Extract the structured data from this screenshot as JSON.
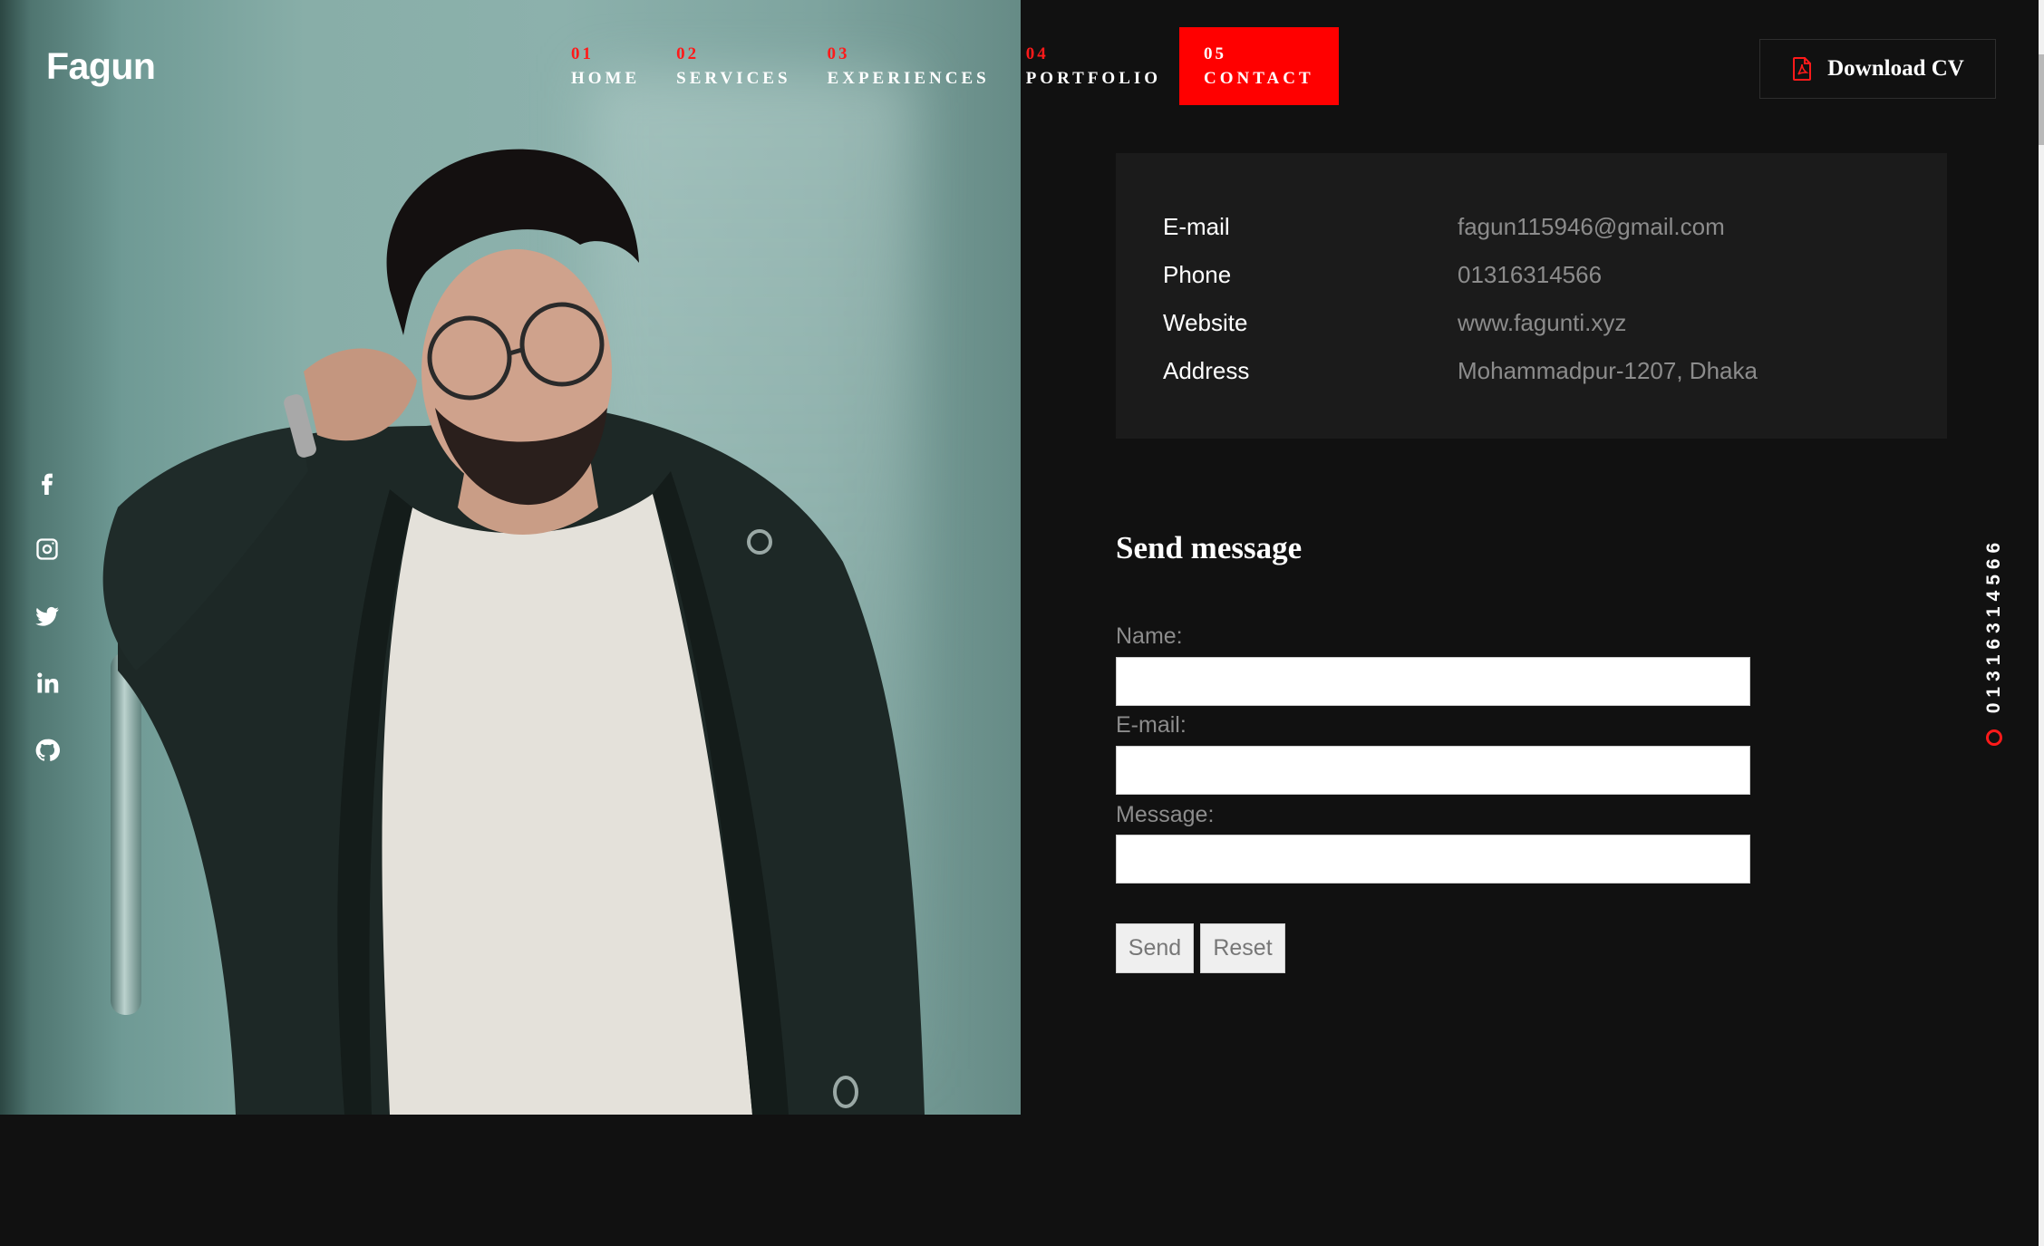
{
  "brand": {
    "name": "Fagun"
  },
  "nav": {
    "items": [
      {
        "num": "01",
        "label": "HOME"
      },
      {
        "num": "02",
        "label": "SERVICES"
      },
      {
        "num": "03",
        "label": "EXPERIENCES"
      },
      {
        "num": "04",
        "label": "PORTFOLIO"
      },
      {
        "num": "05",
        "label": "CONTACT"
      }
    ],
    "active_index": 4,
    "accent_color": "#ff0000"
  },
  "cv_button": {
    "label": "Download CV",
    "icon": "pdf-file-icon"
  },
  "social": {
    "icons": [
      "facebook-icon",
      "instagram-icon",
      "twitter-icon",
      "linkedin-icon",
      "github-icon"
    ]
  },
  "contact_info": {
    "rows": [
      {
        "key": "E-mail",
        "value": "fagun115946@gmail.com"
      },
      {
        "key": "Phone",
        "value": "01316314566"
      },
      {
        "key": "Website",
        "value": "www.fagunti.xyz"
      },
      {
        "key": "Address",
        "value": "Mohammadpur-1207, Dhaka"
      }
    ]
  },
  "form": {
    "title": "Send message",
    "name_label": "Name:",
    "name_value": "",
    "email_label": "E-mail:",
    "email_value": "",
    "message_label": "Message:",
    "message_value": "",
    "send_label": "Send",
    "reset_label": "Reset"
  },
  "side_phone": {
    "text": "01316314566"
  }
}
